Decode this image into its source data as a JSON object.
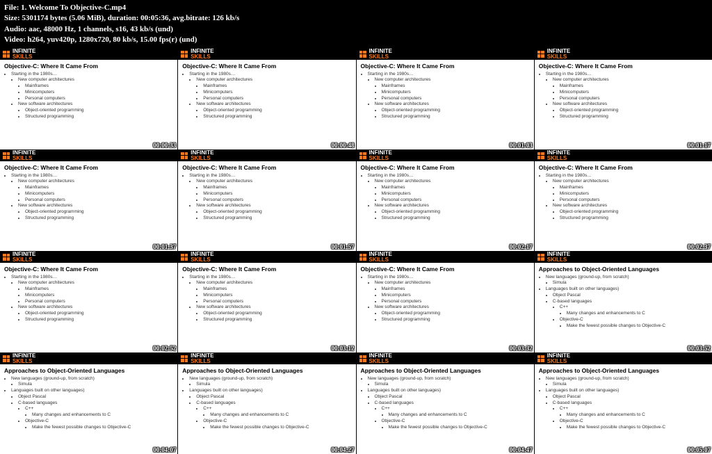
{
  "header": {
    "file_label": "File:",
    "file_value": "1. Welcome To Objective-C.mp4",
    "size_label": "Size:",
    "size_value": "5301174 bytes (5.06 MiB), duration: 00:05:36, avg.bitrate: 126 kb/s",
    "audio_label": "Audio:",
    "audio_value": "aac, 48000 Hz, 1 channels, s16, 43 kb/s (und)",
    "video_label": "Video:",
    "video_value": "h264, yuv420p, 1280x720, 80 kb/s, 15.00 fps(r) (und)"
  },
  "logo": {
    "line1": "INFINITE",
    "line2": "SKILLS"
  },
  "slideA": {
    "title": "Objective-C: Where It Came From",
    "b1": "Starting in the 1980s…",
    "b1a": "New computer architectures",
    "b1a1": "Mainframes",
    "b1a2": "Minicomputers",
    "b1a3": "Personal computers",
    "b1b": "New software architectures",
    "b1b1": "Object-oriented programming",
    "b1b2": "Structured programming"
  },
  "slideB": {
    "title": "Approaches to Object-Oriented Languages",
    "b1": "New languages (ground-up, from scratch)",
    "b1a": "Simula",
    "b2": "Languages built on other languages)",
    "b2a": "Object Pascal",
    "b2b": "C-based languages",
    "b2b1": "C++",
    "b2b1a": "Many changes and enhancements to C",
    "b2b2": "Objective-C",
    "b2b2a": "Make the fewest possible changes to Objective-C"
  },
  "timestamps": [
    "00:00:33",
    "00:00:48",
    "00:01:03",
    "00:01:17",
    "00:01:37",
    "00:01:57",
    "00:02:17",
    "00:02:37",
    "00:02:52",
    "00:03:12",
    "00:03:32",
    "00:03:52",
    "00:04:07",
    "00:04:27",
    "00:04:47",
    "00:05:07"
  ],
  "layout": [
    "A",
    "A",
    "A",
    "A",
    "A",
    "A",
    "A",
    "A",
    "A",
    "A",
    "A",
    "B",
    "B",
    "B",
    "B",
    "B"
  ]
}
